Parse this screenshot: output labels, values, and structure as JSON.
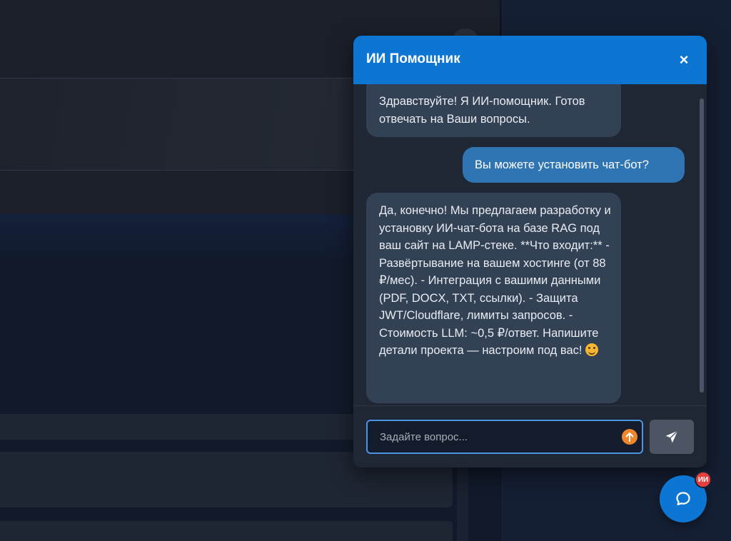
{
  "chat": {
    "title": "ИИ Помощник",
    "close_label": "×",
    "messages": [
      {
        "role": "bot",
        "text": "Здравствуйте! Я ИИ-помощник. Готов отвечать на Ваши вопросы."
      },
      {
        "role": "user",
        "text": "Вы можете установить чат-бот?"
      },
      {
        "role": "bot",
        "text": "Да, конечно! Мы предлагаем разработку и установку ИИ-чат-бота на базе RAG под ваш сайт на LAMP-стеке. **Что входит:** - Развёртывание на вашем хостинге (от 88 ₽/мес). - Интеграция с вашими данными (PDF, DOCX, TXT, ссылки). - Защита JWT/Cloudflare, лимиты запросов. - Стоимость LLM: ~0,5 ₽/ответ. Напишите детали проекта — настроим под вас!",
        "emoji": "smiling-face-icon"
      }
    ],
    "input": {
      "placeholder": "Задайте вопрос...",
      "value": ""
    },
    "icons": {
      "upload": "upload-arrow-icon",
      "send": "paper-plane-icon",
      "launcher": "chat-bubble-icon"
    },
    "launcher_badge": "ИИ"
  },
  "colors": {
    "accent": "#0d75d2",
    "bot_bubble": "#334155",
    "user_bubble": "#2f75b3",
    "badge": "#e53e3e",
    "upload": "#f0862b"
  }
}
